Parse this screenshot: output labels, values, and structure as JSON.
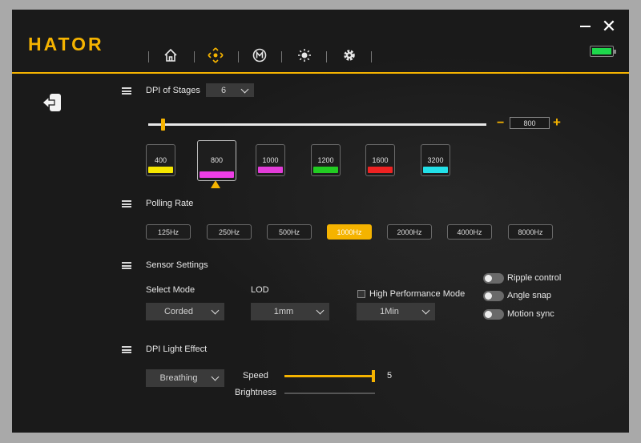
{
  "header": {
    "logo": "HATOR",
    "nav": [
      {
        "name": "home-icon",
        "glyph": "⌂"
      },
      {
        "name": "dpi-icon",
        "glyph": "◈"
      },
      {
        "name": "macro-icon",
        "glyph": "Ⓜ"
      },
      {
        "name": "light-icon",
        "glyph": "☀"
      },
      {
        "name": "settings-icon",
        "glyph": "⚙"
      }
    ],
    "close_glyph": "✕"
  },
  "colors": {
    "accent": "#f5b300",
    "battery": "#1ed84c"
  },
  "dpi": {
    "title": "DPI of Stages",
    "stages_count": "6",
    "slider_value_fraction": 0.02,
    "value": "800",
    "minus": "−",
    "plus": "+",
    "stages": [
      {
        "value": "400",
        "color": "#f5e600"
      },
      {
        "value": "800",
        "color": "#ee3ee6"
      },
      {
        "value": "1000",
        "color": "#e23cd8"
      },
      {
        "value": "1200",
        "color": "#22cc22"
      },
      {
        "value": "1600",
        "color": "#ee2222"
      },
      {
        "value": "3200",
        "color": "#22e0e8"
      }
    ]
  },
  "polling": {
    "title": "Polling Rate",
    "rates": [
      "125Hz",
      "250Hz",
      "500Hz",
      "1000Hz",
      "2000Hz",
      "4000Hz",
      "8000Hz"
    ],
    "active": "1000Hz"
  },
  "sensor": {
    "title": "Sensor Settings",
    "mode_label": "Select Mode",
    "mode_value": "Corded",
    "lod_label": "LOD",
    "lod_value": "1mm",
    "high_perf_label": "High Performance Mode",
    "high_perf_value": "1Min",
    "toggles": [
      "Ripple control",
      "Angle snap",
      "Motion sync"
    ]
  },
  "light": {
    "title": "DPI Light Effect",
    "effect_value": "Breathing",
    "speed_label": "Speed",
    "speed_value": "5",
    "speed_fraction": 1.0,
    "brightness_label": "Brightness",
    "brightness_fraction": 0.0
  }
}
